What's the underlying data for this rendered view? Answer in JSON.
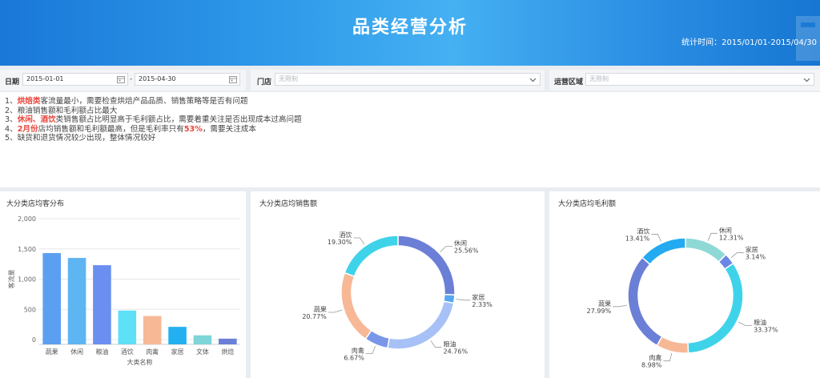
{
  "header": {
    "title": "品类经营分析",
    "stat_label": "统计时间：",
    "stat_range": "2015/01/01-2015/04/30"
  },
  "filters": {
    "date_label": "日期",
    "date_start": "2015-01-01",
    "date_sep": "-",
    "date_end": "2015-04-30",
    "store_label": "门店",
    "store_placeholder": "无限制",
    "region_label": "运营区域",
    "region_placeholder": "无限制"
  },
  "notes": [
    {
      "no": "1、",
      "hl": "烘焙类",
      "rest": "客流量最小，需要检查烘焙产品品质、销售策略等是否有问题"
    },
    {
      "no": "2、",
      "text": "粮油销售额和毛利额占比最大"
    },
    {
      "no": "3、",
      "hl": "休闲、酒饮",
      "rest": "类销售额占比明显高于毛利额占比，需要着重关注是否出现成本过高问题"
    },
    {
      "no": "4、",
      "hl": "2月份",
      "mid": "店均销售额和毛利额最高，但是毛利率只有",
      "hl2": "53%",
      "rest": "，需要关注成本"
    },
    {
      "no": "5、",
      "text": "缺货和退货情况较少出现，整体情况较好"
    }
  ],
  "panels": {
    "traffic_title": "大分类店均客分布",
    "sales_title": "大分类店均销售额",
    "profit_title": "大分类店均毛利额"
  },
  "chart_data": [
    {
      "type": "bar",
      "title": "大分类店均客分布",
      "xlabel": "大类名称",
      "ylabel": "客流量",
      "ylim": [
        0,
        2000
      ],
      "yticks": [
        "0",
        "500",
        "1,000",
        "1,500",
        "2,000"
      ],
      "grid": true,
      "categories": [
        "蔬果",
        "休闲",
        "粮油",
        "酒饮",
        "肉禽",
        "家居",
        "文体",
        "烘焙"
      ],
      "values": [
        1430,
        1350,
        1230,
        480,
        390,
        210,
        70,
        15
      ],
      "colors": [
        "#5b9ff0",
        "#5fb4f2",
        "#6a8ff0",
        "#5ee0f7",
        "#f7b896",
        "#23b0f0",
        "#7dd5d8",
        "#6b7fd6"
      ]
    },
    {
      "type": "pie",
      "title": "大分类店均销售额",
      "categories": [
        "休闲",
        "家居",
        "粮油",
        "肉禽",
        "蔬果",
        "酒饮"
      ],
      "values": [
        25.56,
        2.33,
        24.76,
        6.67,
        20.77,
        19.3
      ],
      "labels": [
        "25.56%",
        "2.33%",
        "24.76%",
        "6.67%",
        "20.77%",
        "19.30%"
      ],
      "colors": [
        "#6b7fd6",
        "#55a8f0",
        "#a7c1f7",
        "#7a96e8",
        "#f7b896",
        "#3fd3ea"
      ]
    },
    {
      "type": "pie",
      "title": "大分类店均毛利额",
      "categories": [
        "休闲",
        "家居",
        "粮油",
        "肉禽",
        "蔬果",
        "酒饮"
      ],
      "values": [
        12.31,
        3.14,
        33.37,
        8.98,
        27.99,
        13.41
      ],
      "labels": [
        "12.31%",
        "3.14%",
        "33.37%",
        "8.98%",
        "27.99%",
        "13.41%"
      ],
      "colors": [
        "#8ed9d6",
        "#6a86e6",
        "#3fd3ea",
        "#f7b896",
        "#6b7fd6",
        "#23aaf0"
      ]
    }
  ],
  "colors": {
    "header_start": "#1a78d8",
    "header_end": "#45b0f2",
    "highlight": "#e8463c",
    "page_bg": "#e9ecf0"
  }
}
